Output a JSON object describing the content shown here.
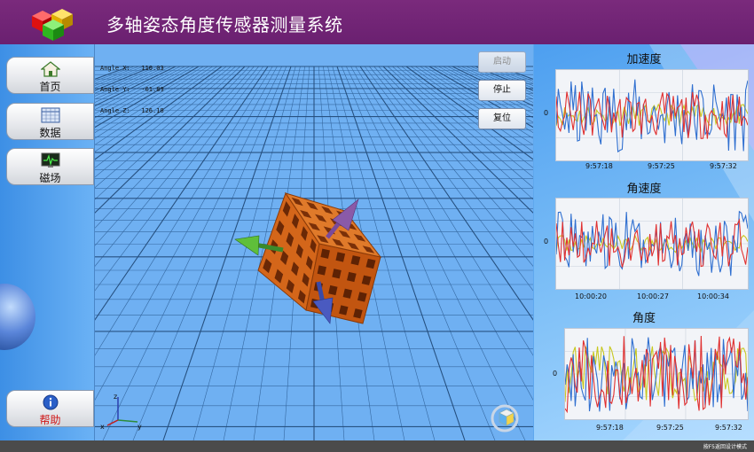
{
  "app": {
    "title": "多轴姿态角度传感器测量系统"
  },
  "sidebar": {
    "items": [
      {
        "label": "首页",
        "icon": "home-icon"
      },
      {
        "label": "数据",
        "icon": "table-icon"
      },
      {
        "label": "磁场",
        "icon": "monitor-icon"
      }
    ],
    "help": {
      "label": "帮助",
      "icon": "info-icon"
    }
  },
  "viewport": {
    "angles": [
      {
        "label": "Angle X:",
        "value": "110.03"
      },
      {
        "label": "Angle Y:",
        "value": "-61.89"
      },
      {
        "label": "Angle Z:",
        "value": "126.18"
      }
    ],
    "buttons": {
      "start": "启动",
      "stop": "停止",
      "reset": "复位"
    },
    "axis_labels": {
      "x": "x",
      "y": "y",
      "z": "z"
    }
  },
  "charts": [
    {
      "title": "加速度",
      "zero_label": "0",
      "ticks": [
        "9:57:18",
        "9:57:25",
        "9:57:32"
      ]
    },
    {
      "title": "角速度",
      "zero_label": "0",
      "ticks": [
        "10:00:20",
        "10:00:27",
        "10:00:34"
      ]
    },
    {
      "title": "角度",
      "zero_label": "0",
      "ticks": [
        "9:57:18",
        "9:57:25",
        "9:57:32"
      ]
    }
  ],
  "series_colors": {
    "x": "#2f6fd0",
    "y": "#e03030",
    "z": "#c8c820"
  },
  "statusbar": {
    "text": "按F5返回设计模式"
  }
}
